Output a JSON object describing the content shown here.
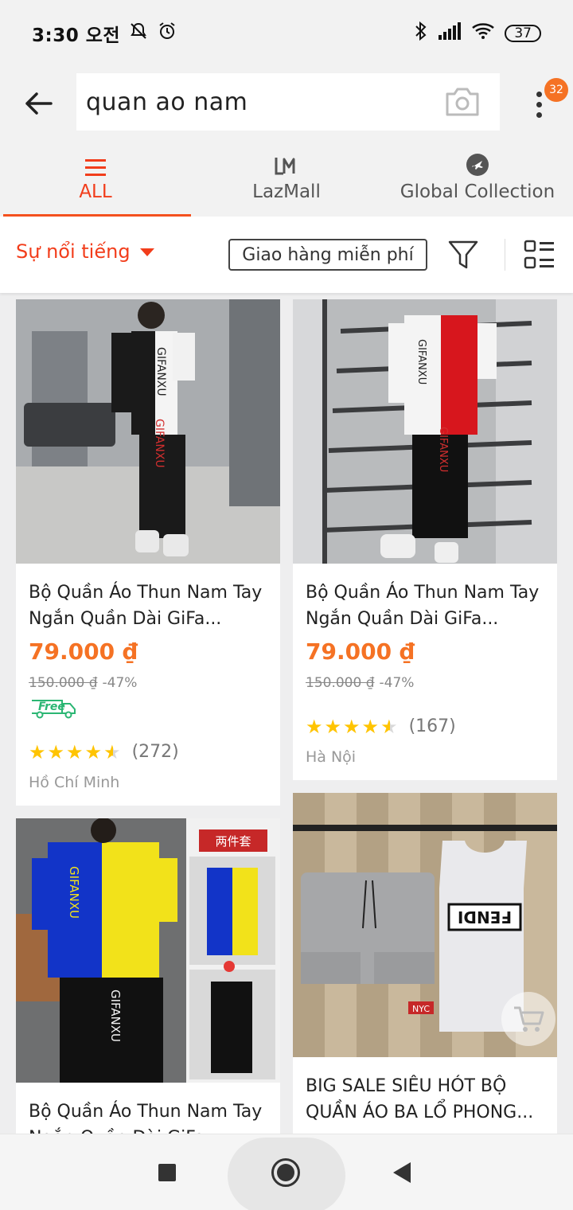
{
  "status_bar": {
    "time": "3:30 오전",
    "battery": "37"
  },
  "search": {
    "query": "quan ao nam",
    "cart_badge": "32"
  },
  "tabs": [
    {
      "label": "ALL",
      "active": true
    },
    {
      "label": "LazMall",
      "active": false
    },
    {
      "label": "Global Collection",
      "active": false
    }
  ],
  "filter_bar": {
    "sort_label": "Sự nổi tiếng",
    "free_shipping_label": "Giao hàng miễn phí"
  },
  "products": [
    {
      "title": "Bộ Quần Áo Thun Nam Tay  Ngắn Quần Dài GiFa...",
      "price": "79.000 ₫",
      "original_price": "150.000 ₫",
      "discount": "-47%",
      "free_shipping": "Free",
      "rating": 4.5,
      "reviews": "(272)",
      "location": "Hồ Chí Minh"
    },
    {
      "title": "Bộ Quần Áo Thun Nam Tay Ngắn Quần Dài GiFa...",
      "price": "79.000 ₫",
      "original_price": "150.000 ₫",
      "discount": "-47%",
      "rating": 4.5,
      "reviews": "(167)",
      "location": "Hà Nội"
    },
    {
      "title": "Bộ Quần Áo Thun Nam Tay Ngắn Quần Dài GiFa...",
      "image_tag": "两件套"
    },
    {
      "title": "BIG SALE SIÊU HÓT BỘ QUẦN ÁO BA LỔ PHONG...",
      "shirt_print": "FENDI"
    }
  ],
  "colors": {
    "accent": "#f23d1b",
    "price": "#f57224",
    "star": "#ffc400"
  }
}
